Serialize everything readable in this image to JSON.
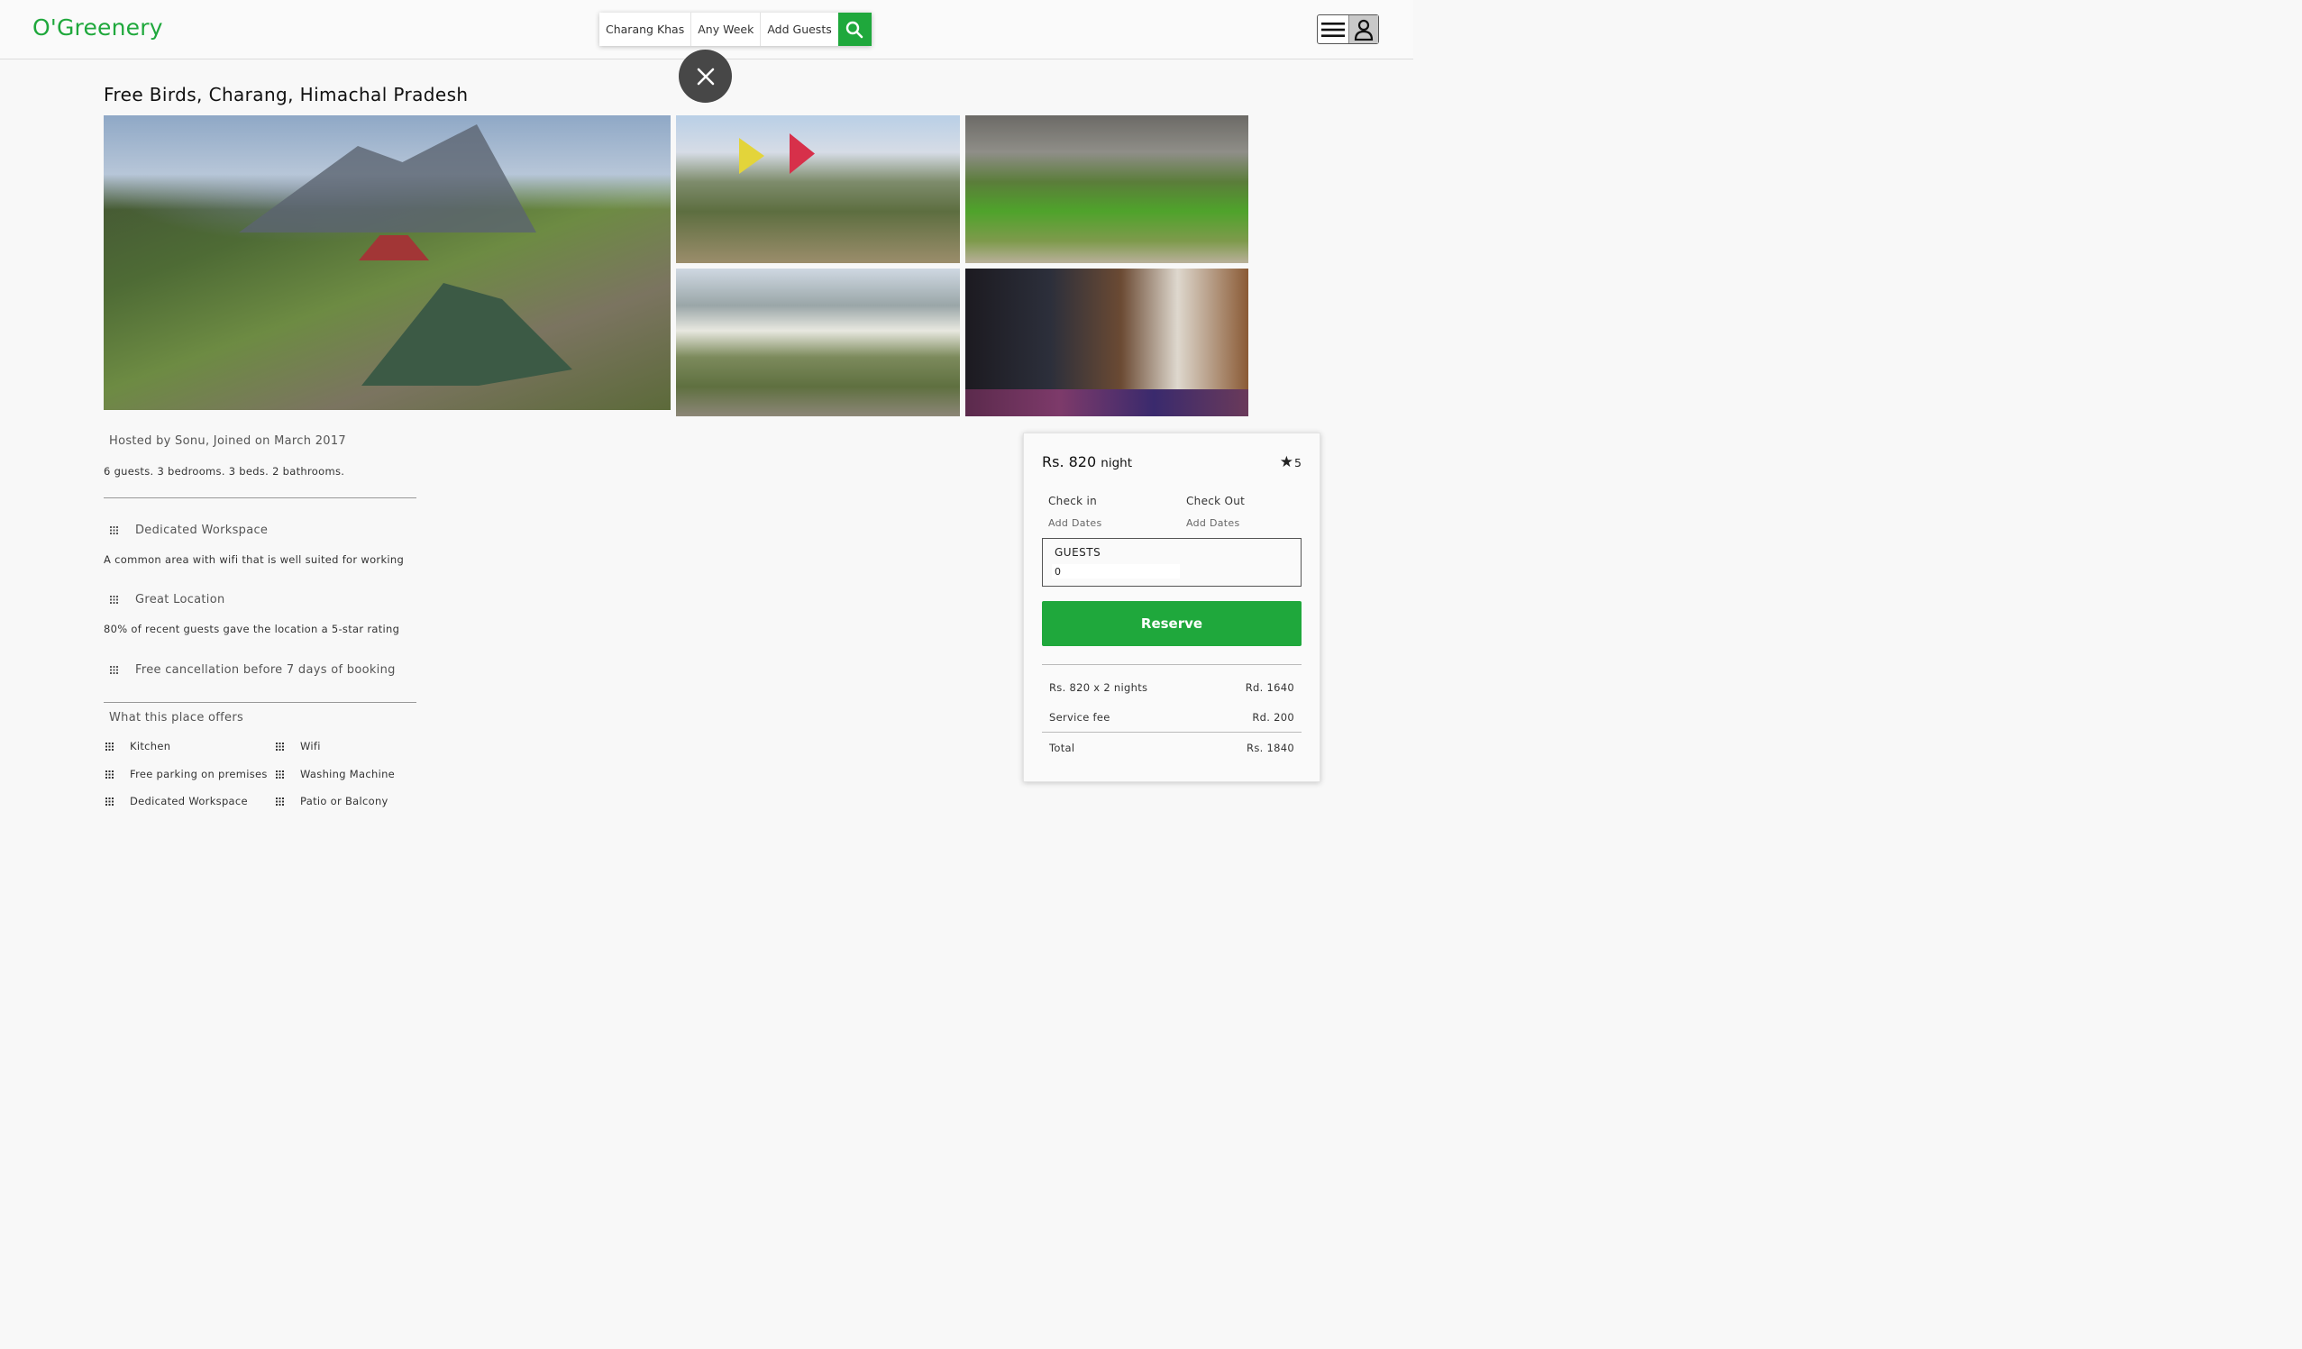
{
  "header": {
    "logo": "O'Greenery",
    "search": {
      "location": "Charang Khas",
      "week": "Any Week",
      "guests": "Add Guests"
    }
  },
  "listing": {
    "title": "Free Birds, Charang, Himachal Pradesh",
    "host": "Hosted by Sonu, Joined on March 2017",
    "stats": "6 guests. 3 bedrooms. 3 beds. 2 bathrooms."
  },
  "features": [
    {
      "title": "Dedicated Workspace",
      "desc": "A common area with wifi that is well suited for working"
    },
    {
      "title": "Great Location",
      "desc": "80% of recent guests gave the location a 5-star rating"
    },
    {
      "title": "Free cancellation before 7 days of booking",
      "desc": ""
    }
  ],
  "offers": {
    "title": "What this place offers",
    "items": [
      "Kitchen",
      "Wifi",
      "Free parking on premises",
      "Washing Machine",
      "Dedicated Workspace",
      "Patio or Balcony"
    ]
  },
  "booking": {
    "price": "Rs. 820",
    "unit": "night",
    "rating": "5",
    "check_in_label": "Check in",
    "check_in_value": "Add Dates",
    "check_out_label": "Check Out",
    "check_out_value": "Add Dates",
    "guests_label": "GUESTS",
    "guests_value": "0",
    "reserve_label": "Reserve",
    "breakdown": [
      {
        "label": "Rs. 820 x 2 nights",
        "amount": "Rd. 1640"
      },
      {
        "label": "Service fee",
        "amount": "Rd. 200"
      }
    ],
    "total_label": "Total",
    "total_amount": "Rs. 1840"
  },
  "colors": {
    "brand": "#1fa83c",
    "close_button": "#474747"
  }
}
